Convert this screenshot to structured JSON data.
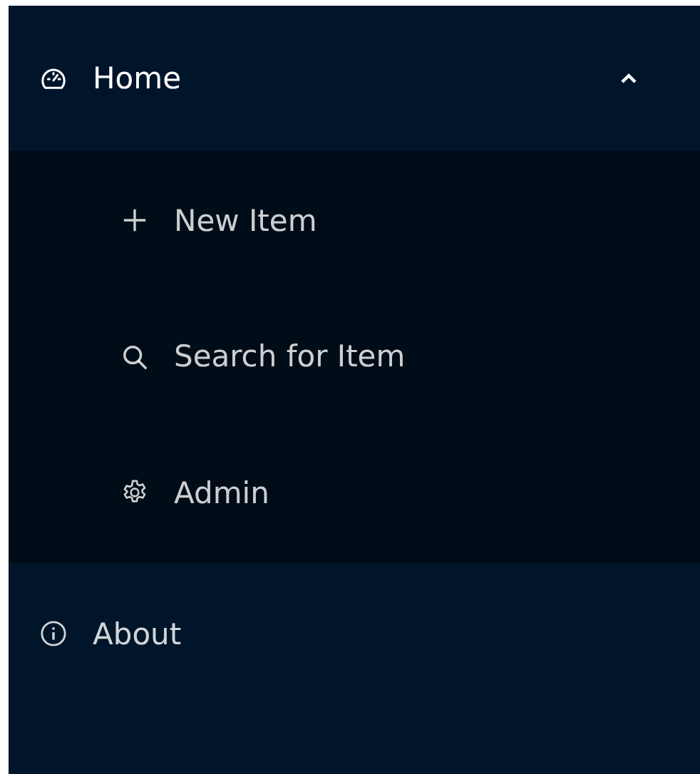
{
  "menu": [
    {
      "label": "Home",
      "expanded": true,
      "children": [
        {
          "label": "New Item"
        },
        {
          "label": "Search for Item"
        },
        {
          "label": "Admin"
        }
      ]
    },
    {
      "label": "About"
    }
  ]
}
